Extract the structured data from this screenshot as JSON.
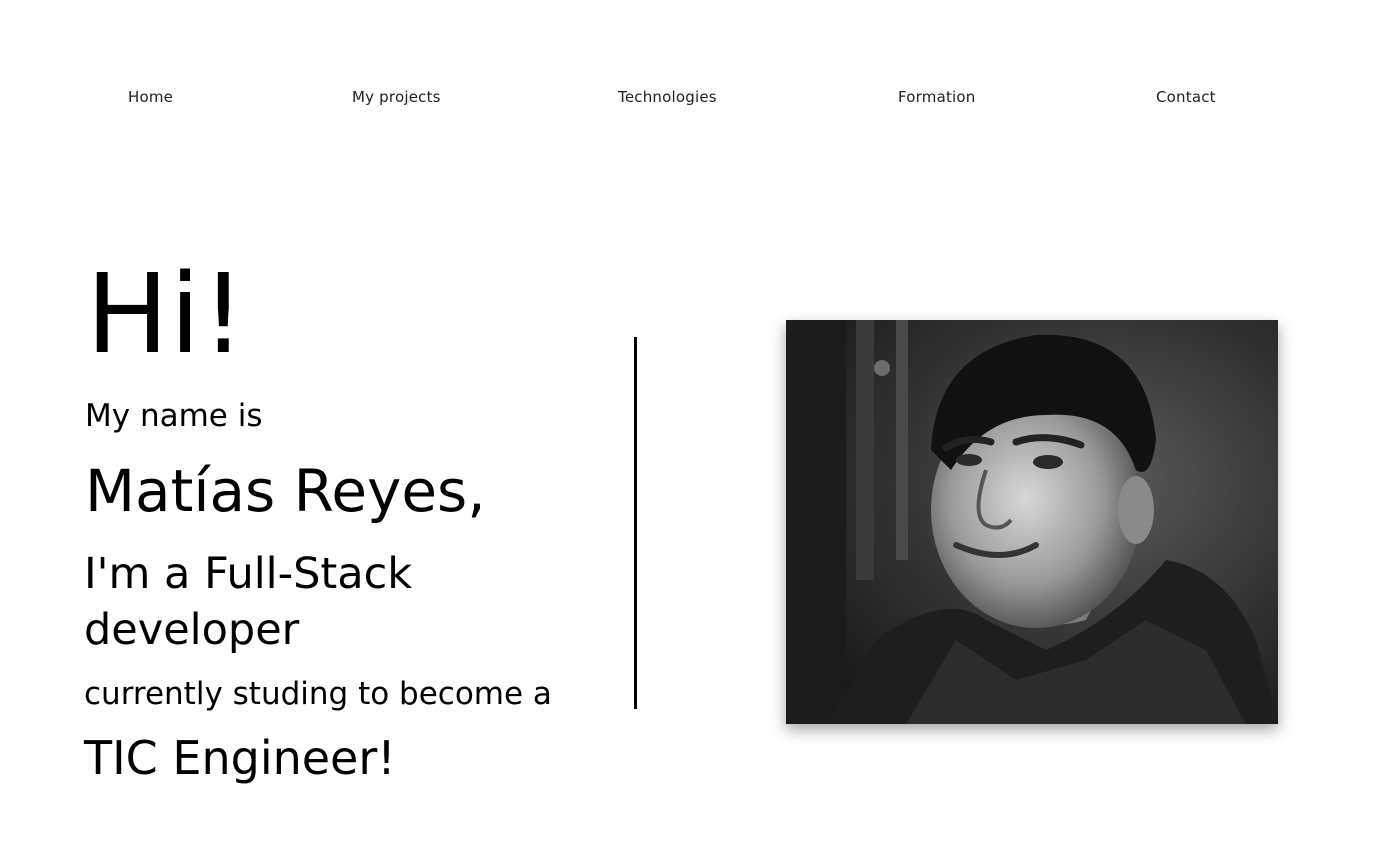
{
  "nav": {
    "home": "Home",
    "projects": "My projects",
    "technologies": "Technologies",
    "formation": "Formation",
    "contact": "Contact"
  },
  "hero": {
    "greeting": "Hi!",
    "name_intro": "My name is",
    "name": "Matías Reyes,",
    "role": "I'm a Full-Stack developer",
    "studying": "currently studing to become a",
    "goal": "TIC Engineer!"
  },
  "photo": {
    "icon": "profile-photo",
    "style": "black-and-white portrait"
  }
}
